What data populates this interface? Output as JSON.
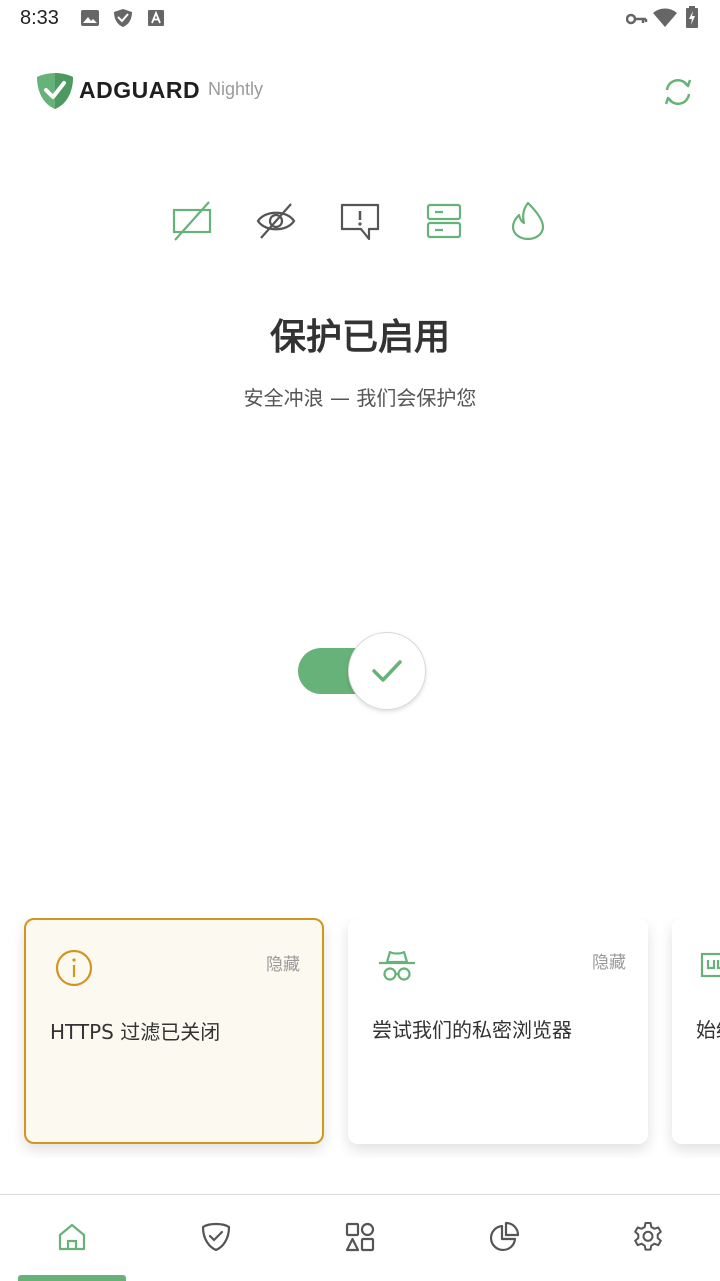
{
  "status_bar": {
    "time": "8:33"
  },
  "header": {
    "brand": "ADGUARD",
    "channel": "Nightly"
  },
  "feature_icons": [
    "ad-blocking-icon",
    "tracking-protection-icon",
    "annoyance-blocking-icon",
    "dns-protection-icon",
    "firewall-icon"
  ],
  "main": {
    "title": "保护已启用",
    "subtitle": "安全冲浪 — 我们会保护您",
    "protection_enabled": true
  },
  "cards": [
    {
      "text": "HTTPS 过滤已关闭",
      "hide_label": "隐藏",
      "icon": "info-icon"
    },
    {
      "text": "尝试我们的私密浏览器",
      "hide_label": "隐藏",
      "icon": "incognito-icon"
    },
    {
      "text": "始终",
      "icon": "cleanup-icon"
    }
  ],
  "bottom_nav": {
    "items": [
      "home-icon",
      "protection-icon",
      "apps-icon",
      "statistics-icon",
      "settings-icon"
    ],
    "active": "home-icon"
  },
  "colors": {
    "accent": "#67b279",
    "warning": "#d4951f",
    "text": "#333333",
    "muted": "#9a9a9a"
  }
}
